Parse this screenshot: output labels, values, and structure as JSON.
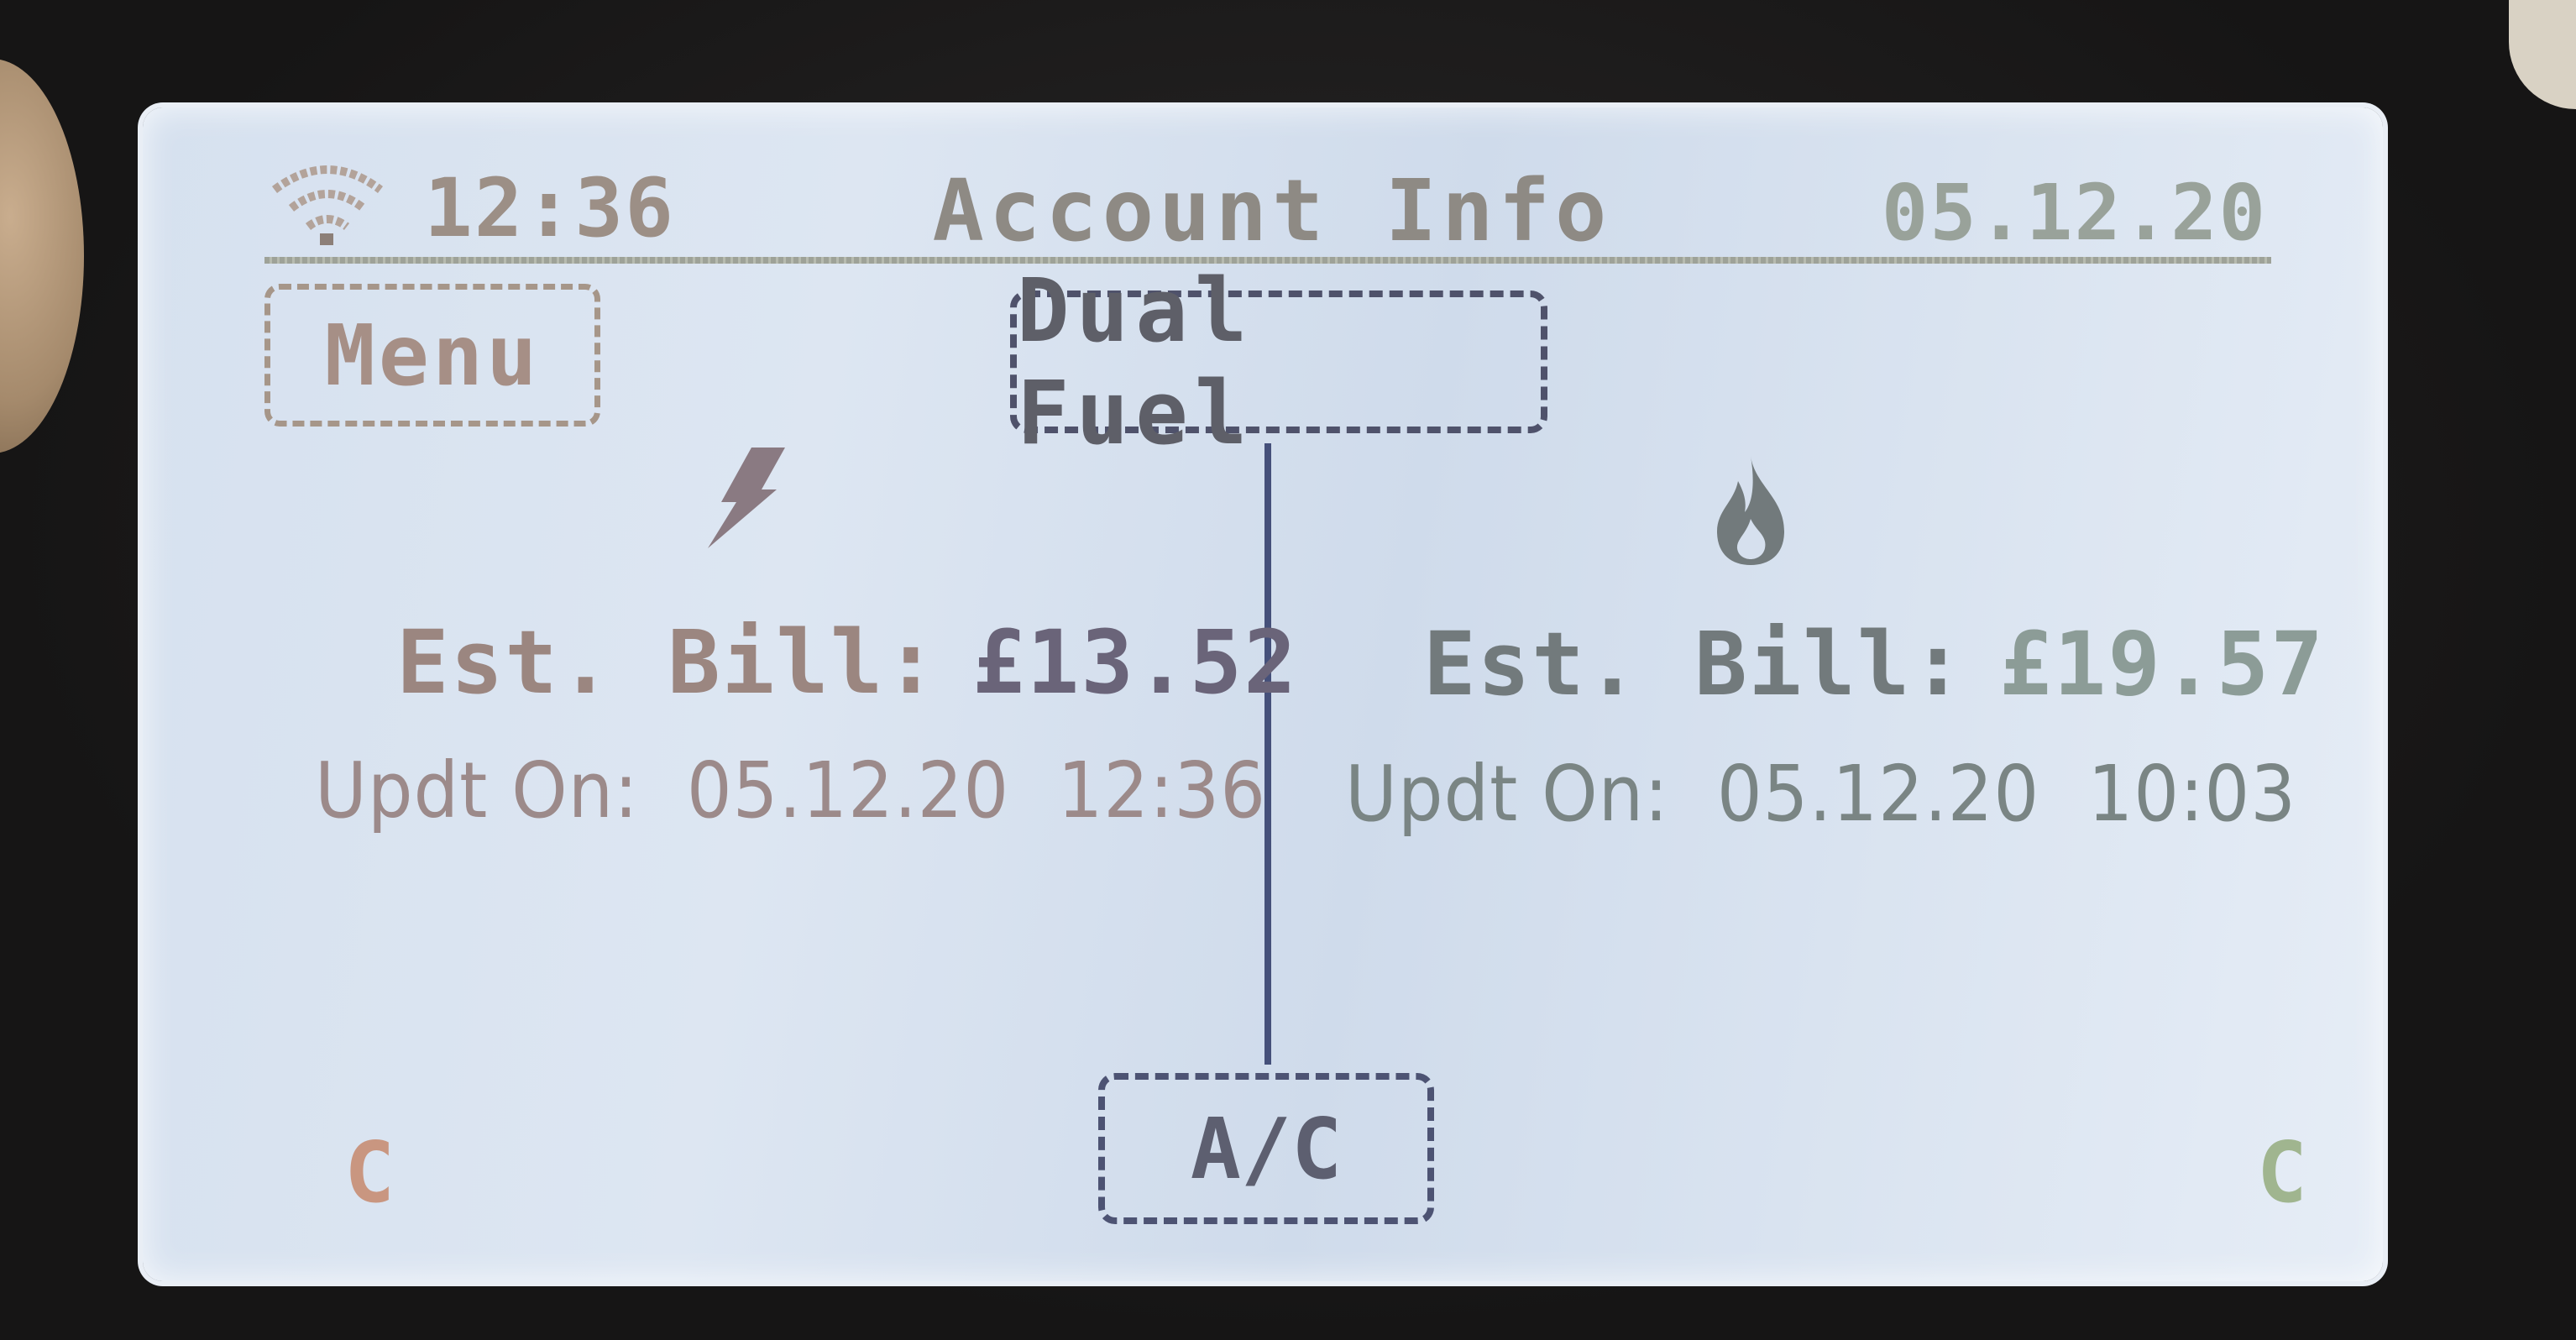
{
  "status_bar": {
    "time": "12:36",
    "title": "Account Info",
    "date": "05.12.20",
    "signal_icon": "wifi-icon"
  },
  "menu_button": {
    "label": "Menu"
  },
  "fuel_tab": {
    "label": "Dual Fuel"
  },
  "electricity": {
    "icon": "lightning-bolt-icon",
    "bill_label": "Est. Bill:",
    "bill_amount": "£13.52",
    "updated_label": "Updt On:",
    "updated_date": "05.12.20",
    "updated_time": "12:36",
    "corner_letter": "C"
  },
  "gas": {
    "icon": "flame-icon",
    "bill_label": "Est. Bill:",
    "bill_amount": "£19.57",
    "updated_label": "Updt On:",
    "updated_date": "05.12.20",
    "updated_time": "10:03",
    "corner_letter": "C"
  },
  "ac_button": {
    "label": "A/C"
  },
  "colors": {
    "screen_background": "#d9e3f0",
    "divider": "#45507a",
    "electric_accent": "#9b8680",
    "gas_accent": "#8c9c97"
  }
}
